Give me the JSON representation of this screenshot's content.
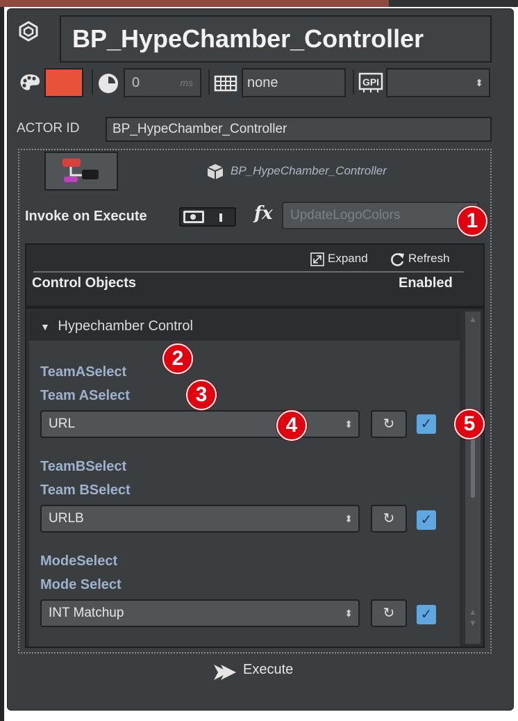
{
  "title": "BP_HypeChamber_Controller",
  "toolbar": {
    "delay_value": "0",
    "delay_unit": "ms",
    "tag_value": "none",
    "gpi_value": "",
    "color": "#e8513a"
  },
  "actor": {
    "label": "ACTOR ID",
    "value": "BP_HypeChamber_Controller",
    "blueprint_ref": "BP_HypeChamber_Controller"
  },
  "invoke": {
    "label": "Invoke on Execute",
    "fx_label": "fx",
    "function_placeholder": "UpdateLogoColors"
  },
  "markers": [
    "1",
    "2",
    "3",
    "4",
    "5"
  ],
  "control_objects": {
    "expand_label": "Expand",
    "refresh_label": "Refresh",
    "header_left": "Control Objects",
    "header_right": "Enabled",
    "group": {
      "toggle": "▼",
      "name": "Hypechamber Control"
    },
    "items": [
      {
        "id": "TeamASelect",
        "name": "Team ASelect",
        "value": "URL",
        "enabled": true
      },
      {
        "id": "TeamBSelect",
        "name": "Team BSelect",
        "value": "URLB",
        "enabled": true
      },
      {
        "id": "ModeSelect",
        "name": "Mode Select",
        "value": "INT Matchup",
        "enabled": true
      }
    ]
  },
  "execute_label": "Execute",
  "icons": [
    "hexagon-logo-icon",
    "palette-icon",
    "clock-icon",
    "grid-icon",
    "gpi-icon",
    "blueprint-icon",
    "cube-icon",
    "expand-icon",
    "refresh-icon",
    "reset-icon",
    "check-icon",
    "execute-icon"
  ],
  "colors": {
    "accent": "#5fa7e0",
    "marker": "#e2000f",
    "label": "#9fb2cd",
    "panel": "#3b3e41"
  }
}
